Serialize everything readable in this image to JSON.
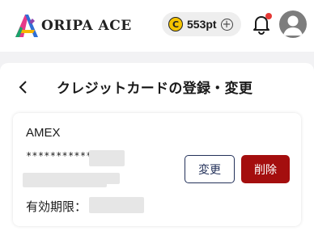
{
  "header": {
    "logo_text": "ORIPA ACE",
    "points_value": "553pt",
    "points_coin_glyph": "C",
    "points_add_glyph": "+",
    "has_notification": true
  },
  "page": {
    "back_glyph": "‹",
    "title": "クレジットカードの登録・変更"
  },
  "card": {
    "brand": "AMEX",
    "number_masked": "***********",
    "expiry_label": "有効期限：",
    "edit_label": "変更",
    "delete_label": "削除"
  },
  "colors": {
    "edit_border": "#23315a",
    "delete_bg": "#a40e0e",
    "coin": "#f5c400",
    "notification_dot": "#e53935"
  }
}
